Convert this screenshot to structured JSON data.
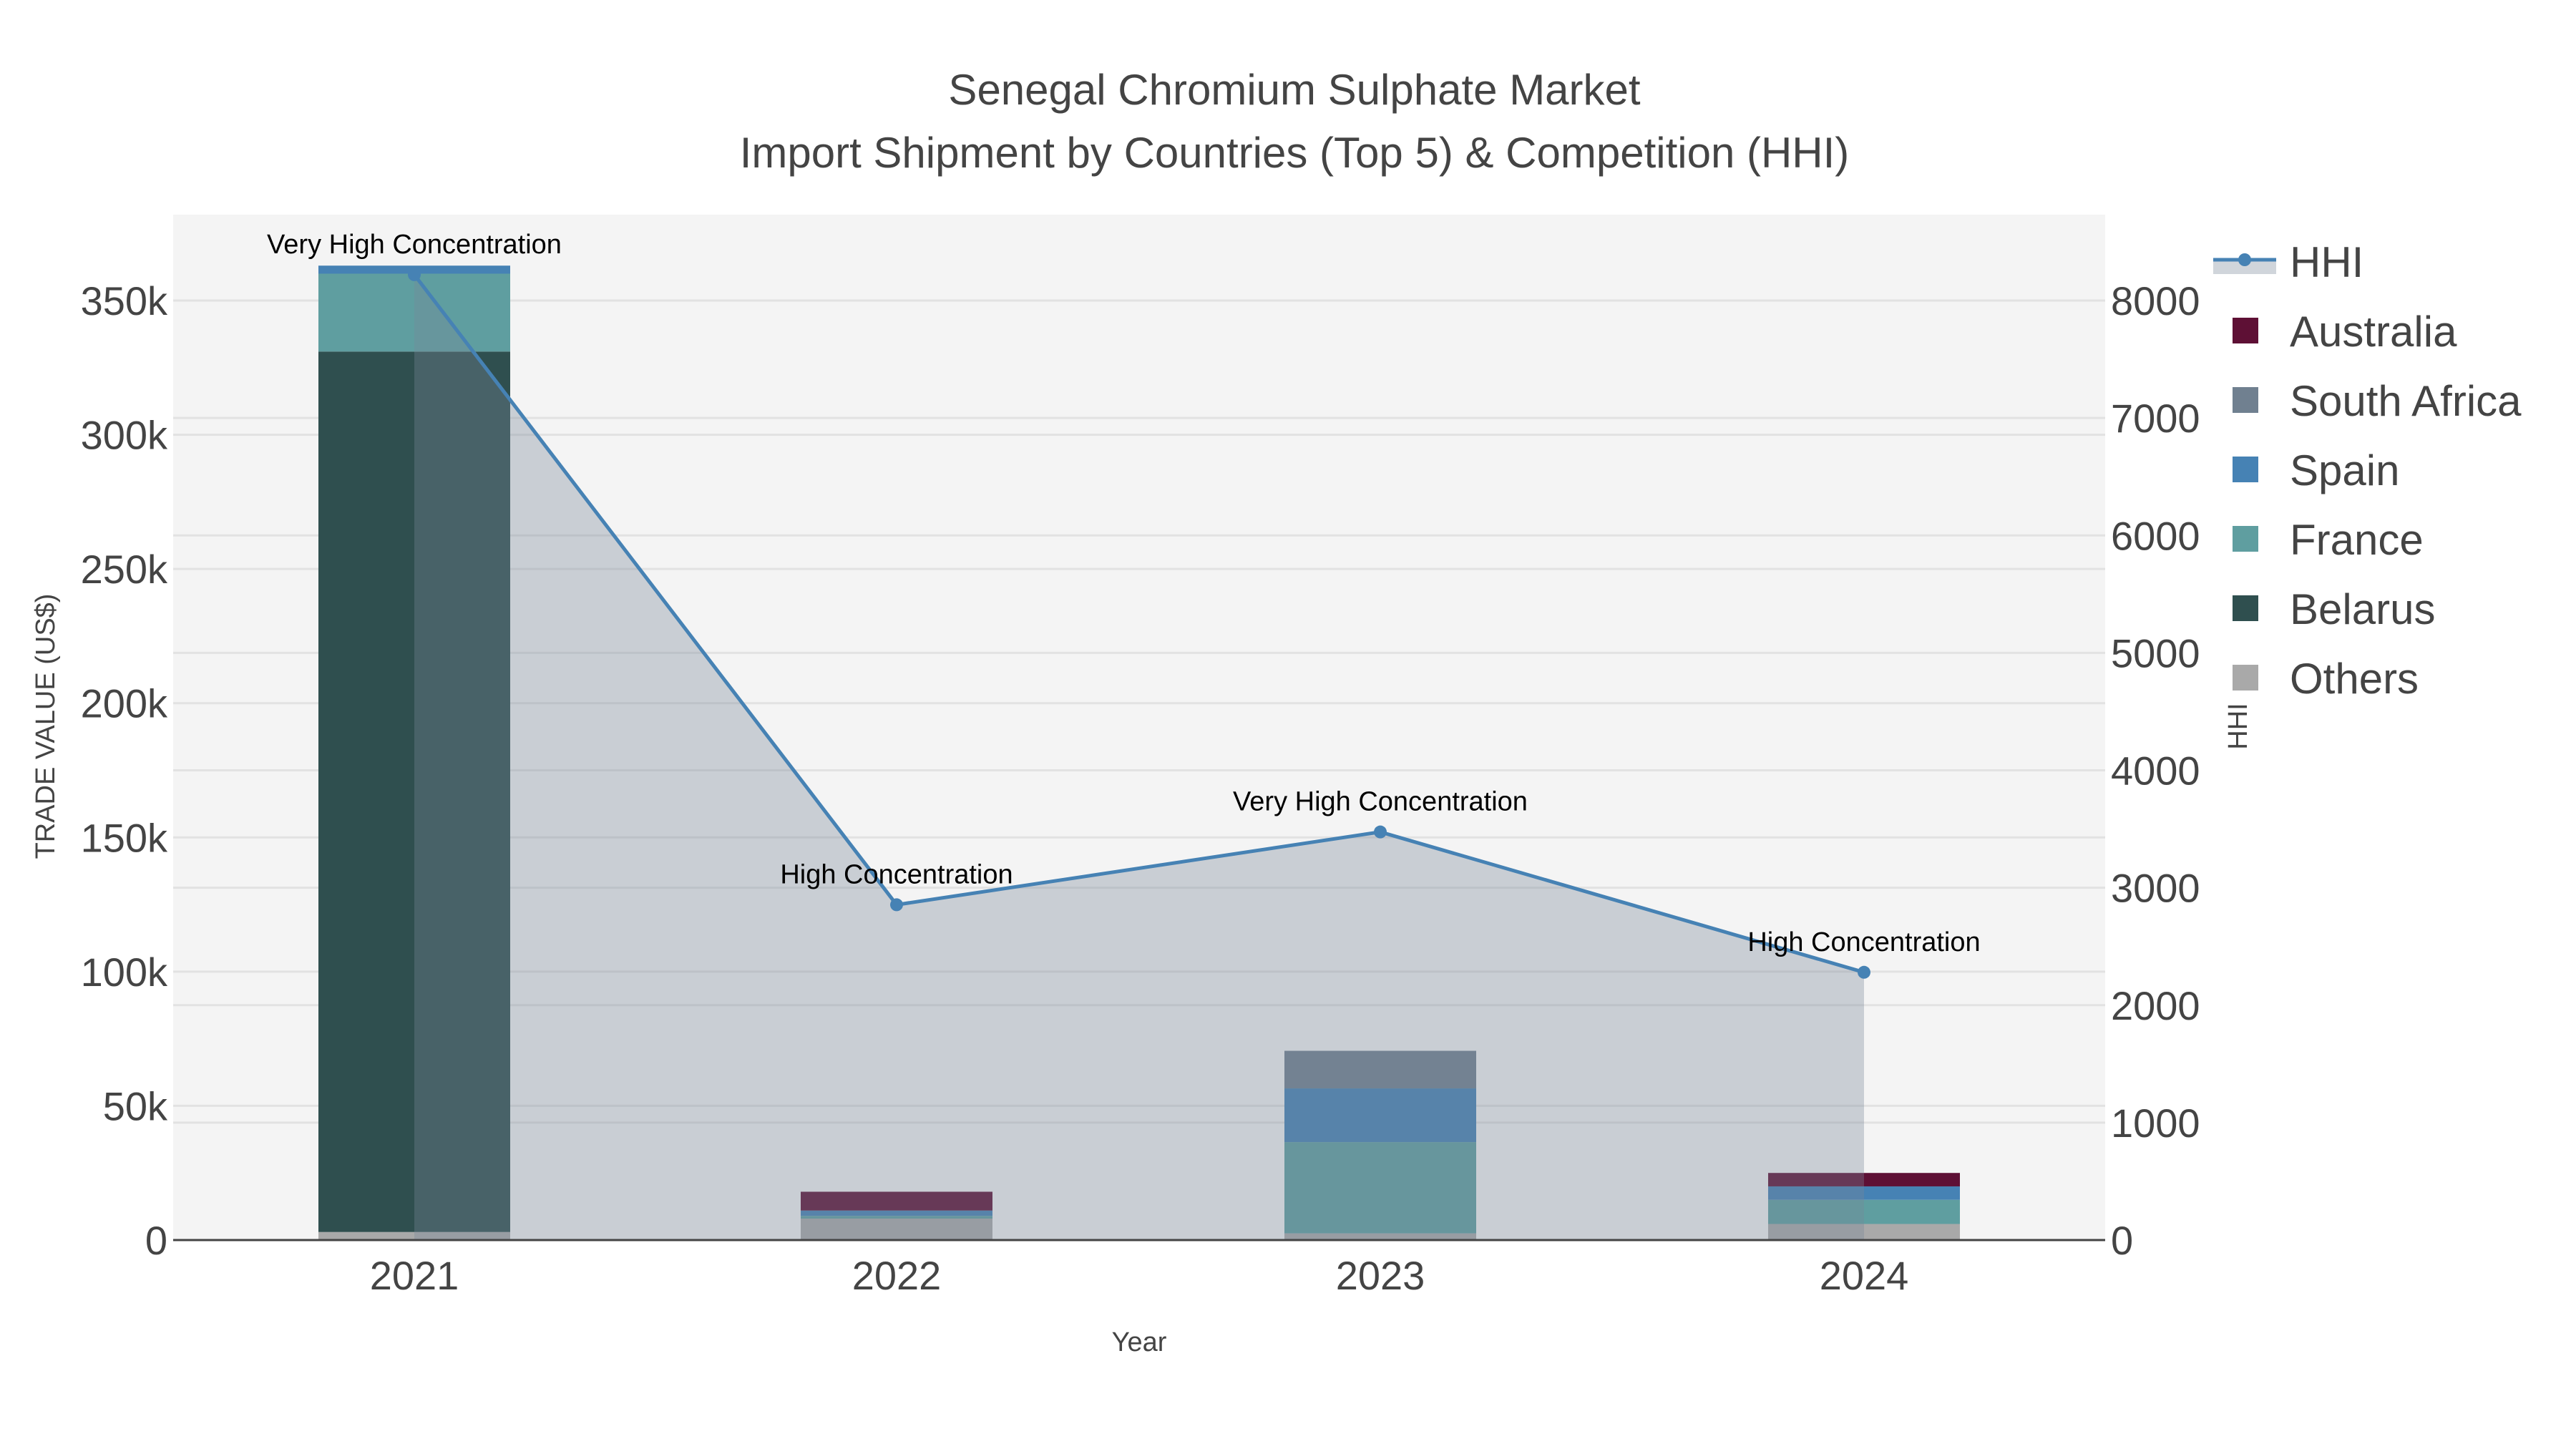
{
  "chart_data": {
    "type": "bar",
    "title_line1": "Senegal Chromium Sulphate Market",
    "title_line2": "Import Shipment by Countries (Top 5) & Competition (HHI)",
    "xlabel": "Year",
    "ylabel": "TRADE VALUE (US$)",
    "y2label": "HHI",
    "categories": [
      "2021",
      "2022",
      "2023",
      "2024"
    ],
    "ylim": [
      0,
      380000
    ],
    "y2lim": [
      0,
      8700
    ],
    "yticks": [
      0,
      50000,
      100000,
      150000,
      200000,
      250000,
      300000,
      350000
    ],
    "ytick_labels": [
      "0",
      "50k",
      "100k",
      "150k",
      "200k",
      "250k",
      "300k",
      "350k"
    ],
    "y2ticks": [
      0,
      1000,
      2000,
      3000,
      4000,
      5000,
      6000,
      7000,
      8000
    ],
    "y2tick_labels": [
      "0",
      "1000",
      "2000",
      "3000",
      "4000",
      "5000",
      "6000",
      "7000",
      "8000"
    ],
    "stack_order": [
      "Others",
      "Belarus",
      "France",
      "Spain",
      "South Africa",
      "Australia"
    ],
    "series": [
      {
        "name": "Australia",
        "color": "#5e1035",
        "values": [
          0,
          7000,
          0,
          5000
        ]
      },
      {
        "name": "South Africa",
        "color": "#708090",
        "values": [
          0,
          0,
          14000,
          0
        ]
      },
      {
        "name": "Spain",
        "color": "#4682b4",
        "values": [
          3000,
          2000,
          20000,
          5000
        ]
      },
      {
        "name": "France",
        "color": "#5f9ea0",
        "values": [
          29000,
          1000,
          34000,
          9000
        ]
      },
      {
        "name": "Belarus",
        "color": "#2f4f4f",
        "values": [
          328000,
          0,
          0,
          0
        ]
      },
      {
        "name": "Others",
        "color": "#a9a9a9",
        "values": [
          3000,
          8000,
          2500,
          6000
        ]
      }
    ],
    "hhi": {
      "name": "HHI",
      "color": "#4682b4",
      "values": [
        8220,
        2855,
        3475,
        2280
      ],
      "labels": [
        "Very High Concentration",
        "High Concentration",
        "Very High Concentration",
        "High Concentration"
      ]
    },
    "legend": [
      "HHI",
      "Australia",
      "South Africa",
      "Spain",
      "France",
      "Belarus",
      "Others"
    ],
    "legend_position": "right",
    "grid": true
  }
}
